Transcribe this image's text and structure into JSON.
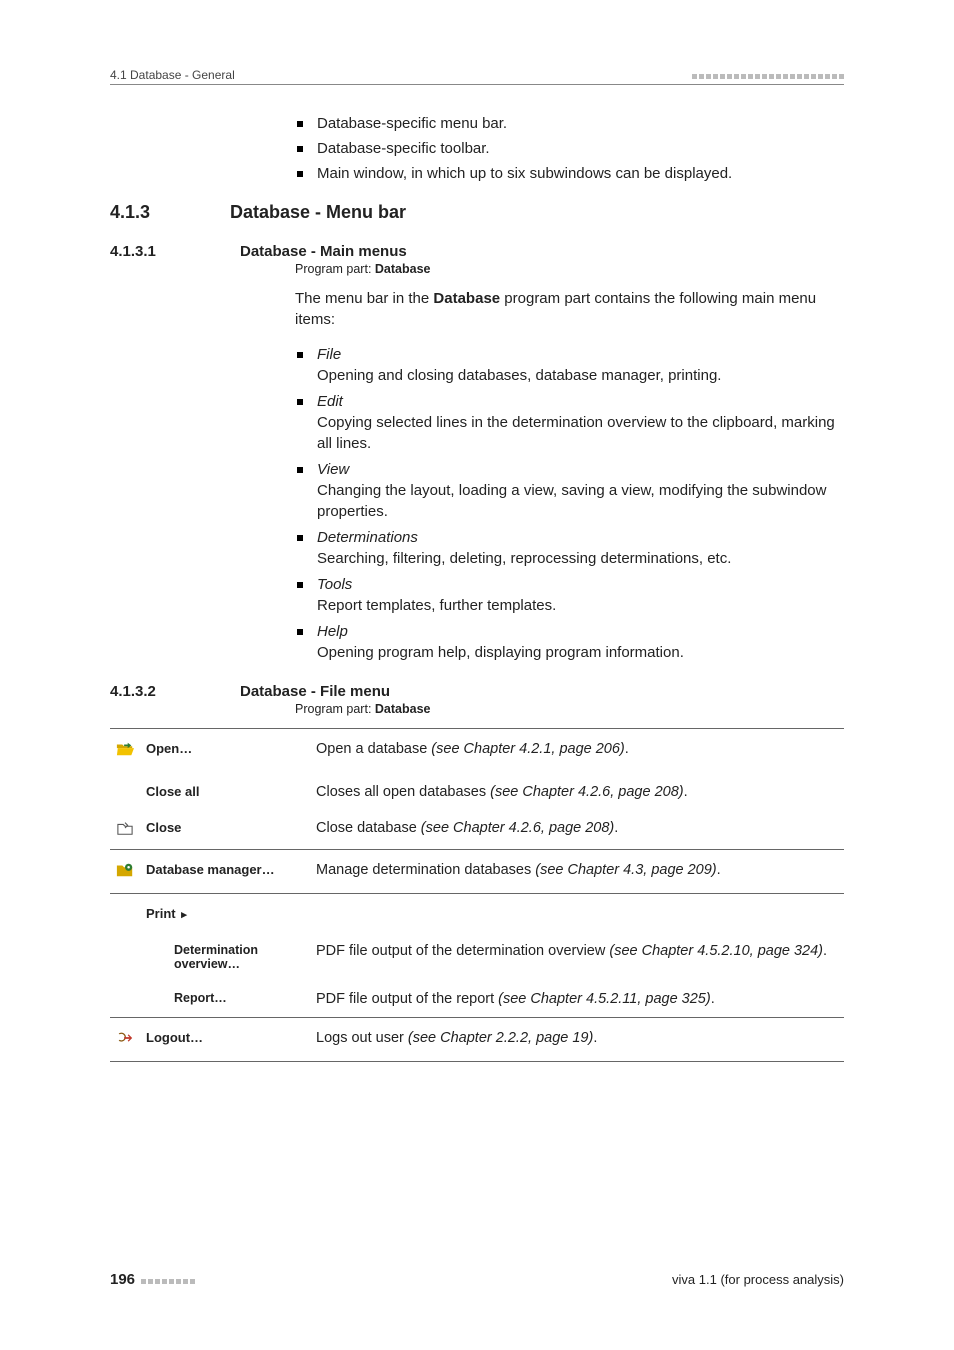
{
  "header": {
    "section_label": "4.1 Database - General"
  },
  "top_bullets": [
    "Database-specific menu bar.",
    "Database-specific toolbar.",
    "Main window, in which up to six subwindows can be displayed."
  ],
  "h413": {
    "num": "4.1.3",
    "title": "Database - Menu bar"
  },
  "h4131": {
    "num": "4.1.3.1",
    "title": "Database - Main menus",
    "program_part_prefix": "Program part: ",
    "program_part_value": "Database",
    "intro_pre": "The menu bar in the ",
    "intro_bold": "Database",
    "intro_post": " program part contains the following main menu items:",
    "menus": [
      {
        "name": "File",
        "desc": "Opening and closing databases, database manager, printing."
      },
      {
        "name": "Edit",
        "desc": "Copying selected lines in the determination overview to the clipboard, marking all lines."
      },
      {
        "name": "View",
        "desc": "Changing the layout, loading a view, saving a view, modifying the subwindow properties."
      },
      {
        "name": "Determinations",
        "desc": "Searching, filtering, deleting, reprocessing determinations, etc."
      },
      {
        "name": "Tools",
        "desc": "Report templates, further templates."
      },
      {
        "name": "Help",
        "desc": "Opening program help, displaying program information."
      }
    ]
  },
  "h4132": {
    "num": "4.1.3.2",
    "title": "Database - File menu",
    "program_part_prefix": "Program part: ",
    "program_part_value": "Database",
    "rows": {
      "open": {
        "label": "Open…",
        "desc_pre": "Open a database ",
        "desc_ital": "(see Chapter 4.2.1, page 206)",
        "desc_post": "."
      },
      "close_all": {
        "label": "Close all",
        "desc_pre": "Closes all open databases ",
        "desc_ital": "(see Chapter 4.2.6, page 208)",
        "desc_post": "."
      },
      "close": {
        "label": "Close",
        "desc_pre": "Close database ",
        "desc_ital": "(see Chapter 4.2.6, page 208)",
        "desc_post": "."
      },
      "dbm": {
        "label": "Database manager…",
        "desc_pre": "Manage determination databases ",
        "desc_ital": "(see Chapter 4.3, page 209)",
        "desc_post": "."
      },
      "print": {
        "label": "Print ",
        "arrow": "▸"
      },
      "det_over": {
        "label": "Determination overview…",
        "desc_pre": "PDF file output of the determination overview ",
        "desc_ital": "(see Chapter 4.5.2.10, page 324)",
        "desc_post": "."
      },
      "report": {
        "label": "Report…",
        "desc_pre": "PDF file output of the report ",
        "desc_ital": "(see Chapter 4.5.2.11, page 325)",
        "desc_post": "."
      },
      "logout": {
        "label": "Logout…",
        "desc_pre": "Logs out user ",
        "desc_ital": "(see Chapter 2.2.2, page 19)",
        "desc_post": "."
      }
    }
  },
  "footer": {
    "page_number": "196",
    "product": "viva 1.1 (for process analysis)"
  }
}
